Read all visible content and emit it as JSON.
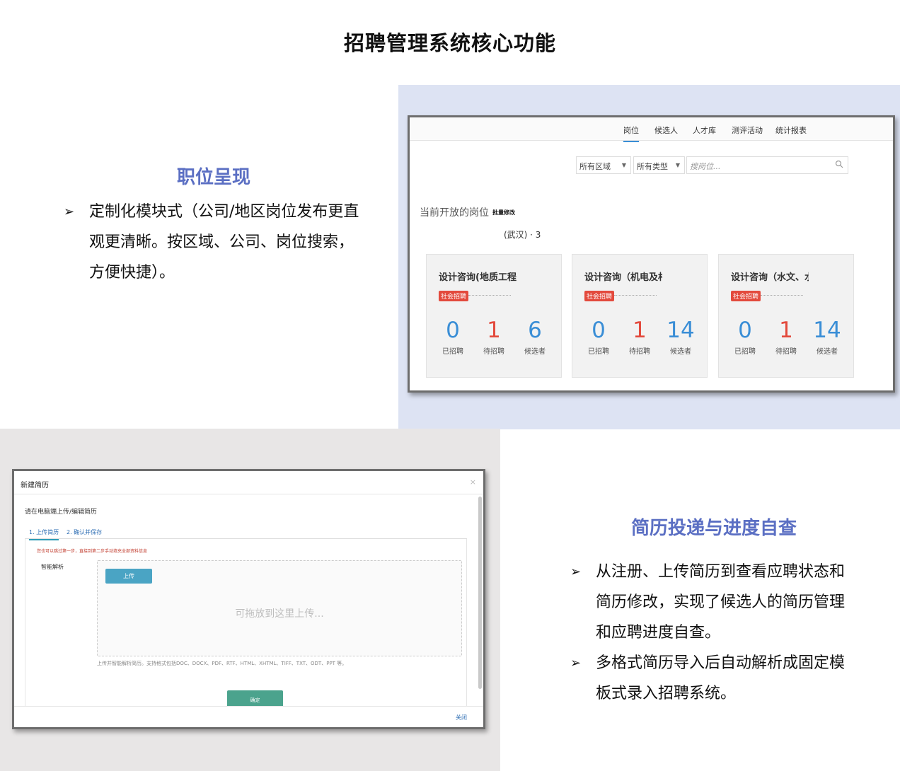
{
  "page": {
    "title": "招聘管理系统核心功能"
  },
  "section1": {
    "heading": "职位呈现",
    "bullets": [
      "定制化模块式（公司/地区岗位发布更直观更清晰。按区域、公司、岗位搜索，方便快捷）。"
    ]
  },
  "section2": {
    "heading": "简历投递与进度自查",
    "bullets": [
      "从注册、上传简历到查看应聘状态和简历修改，实现了候选人的简历管理和应聘进度自查。",
      "多格式简历导入后自动解析成固定模板式录入招聘系统。"
    ]
  },
  "jobs_screen": {
    "nav": [
      "岗位",
      "候选人",
      "人才库",
      "测评活动",
      "统计报表"
    ],
    "active_nav": "岗位",
    "filters": {
      "area": "所有区域",
      "type": "所有类型",
      "search_placeholder": "搜岗位..."
    },
    "section_label": "当前开放的岗位",
    "bulk_edit": "批量修改",
    "location": "(武汉) · 3",
    "stat_labels": [
      "已招聘",
      "待招聘",
      "候选者"
    ],
    "cards": [
      {
        "title": "设计咨询(地质工程",
        "tag": "社会招聘",
        "hired": "0",
        "pending": "1",
        "candidates": "6"
      },
      {
        "title": "设计咨询（机电及村",
        "tag": "社会招聘",
        "hired": "0",
        "pending": "1",
        "candidates": "14"
      },
      {
        "title": "设计咨询（水文、水",
        "tag": "社会招聘",
        "hired": "0",
        "pending": "1",
        "candidates": "14"
      }
    ],
    "colors": {
      "hired": "#3a8ed6",
      "pending": "#e34a3d",
      "candidates": "#3a8ed6"
    }
  },
  "resume_screen": {
    "title": "新建简历",
    "close_symbol": "×",
    "intro": "请在电脑端上传/编辑简历",
    "tabs": [
      "1. 上传简历",
      "2. 确认并保存"
    ],
    "warning": "您也可以跳过第一步，直接到第二步手动填充全部资料信息",
    "parse_label": "智能解析",
    "upload_button": "上传",
    "drop_text": "可拖放到这里上传...",
    "format_hint": "上传并智能解析简历。支持格式包括DOC、DOCX、PDF、RTF、HTML、XHTML、TIFF、TXT、ODT、PPT 等。",
    "confirm_button": "确定",
    "close_link": "关闭"
  }
}
